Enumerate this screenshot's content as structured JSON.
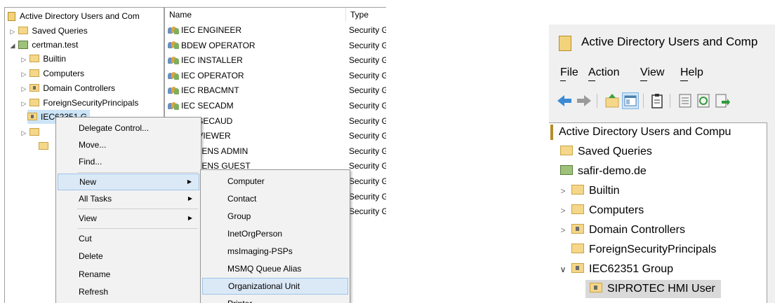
{
  "left_window": {
    "tree": {
      "root": "Active Directory Users and Com",
      "items": [
        {
          "label": "Saved Queries",
          "expander": "▷"
        },
        {
          "label": "certman.test",
          "expander": "◢"
        },
        {
          "label": "Builtin",
          "expander": "▷"
        },
        {
          "label": "Computers",
          "expander": "▷"
        },
        {
          "label": "Domain Controllers",
          "expander": "▷"
        },
        {
          "label": "ForeignSecurityPrincipals",
          "expander": "▷"
        },
        {
          "label": "IEC62351 G",
          "expander": ""
        }
      ]
    },
    "list": {
      "headers": {
        "name": "Name",
        "type": "Type"
      },
      "rows": [
        {
          "name": "IEC ENGINEER",
          "type": "Security G"
        },
        {
          "name": "BDEW OPERATOR",
          "type": "Security G"
        },
        {
          "name": "IEC INSTALLER",
          "type": "Security G"
        },
        {
          "name": "IEC OPERATOR",
          "type": "Security G"
        },
        {
          "name": "IEC RBACMNT",
          "type": "Security G"
        },
        {
          "name": "IEC SECADM",
          "type": "Security G"
        },
        {
          "name": "IEC SECAUD",
          "type": "Security G"
        },
        {
          "name": "IEC VIEWER",
          "type": "Security G"
        },
        {
          "name": "SIEMENS ADMIN",
          "type": "Security G"
        },
        {
          "name": "SIEMENS GUEST",
          "type": "Security G"
        },
        {
          "name": "",
          "type": "Security G"
        },
        {
          "name": "",
          "type": "Security G"
        },
        {
          "name": "",
          "type": "Security G"
        }
      ]
    },
    "context_menu": {
      "items": [
        "Delegate Control...",
        "Move...",
        "Find...",
        "New",
        "All Tasks",
        "View",
        "Cut",
        "Delete",
        "Rename",
        "Refresh"
      ],
      "highlighted": "New"
    },
    "submenu": {
      "items": [
        "Computer",
        "Contact",
        "Group",
        "InetOrgPerson",
        "msImaging-PSPs",
        "MSMQ Queue Alias",
        "Organizational Unit",
        "Printer"
      ],
      "highlighted": "Organizational Unit"
    }
  },
  "right_window": {
    "title": "Active Directory Users and Comp",
    "menu": {
      "file": "File",
      "action": "Action",
      "view": "View",
      "help": "Help"
    },
    "tree": {
      "root": "Active Directory Users and Compu",
      "items": [
        {
          "label": "Saved Queries"
        },
        {
          "label": "safir-demo.de"
        },
        {
          "label": "Builtin"
        },
        {
          "label": "Computers"
        },
        {
          "label": "Domain Controllers"
        },
        {
          "label": "ForeignSecurityPrincipals"
        },
        {
          "label": "IEC62351 Group"
        },
        {
          "label": "SIPROTEC HMI User"
        }
      ]
    }
  },
  "colors": {
    "highlight": "#dbe9f7",
    "highlight_border": "#9ec3e6",
    "menu_bg": "#f2f2f2",
    "folder": "#f5d78a",
    "selected_item": "#d9d9d9"
  },
  "icons": [
    "folder-icon",
    "domain-icon",
    "group-icon",
    "back-arrow-icon",
    "forward-arrow-icon",
    "up-folder-icon",
    "console-tree-icon",
    "clipboard-icon",
    "properties-icon",
    "refresh-icon",
    "export-icon"
  ]
}
